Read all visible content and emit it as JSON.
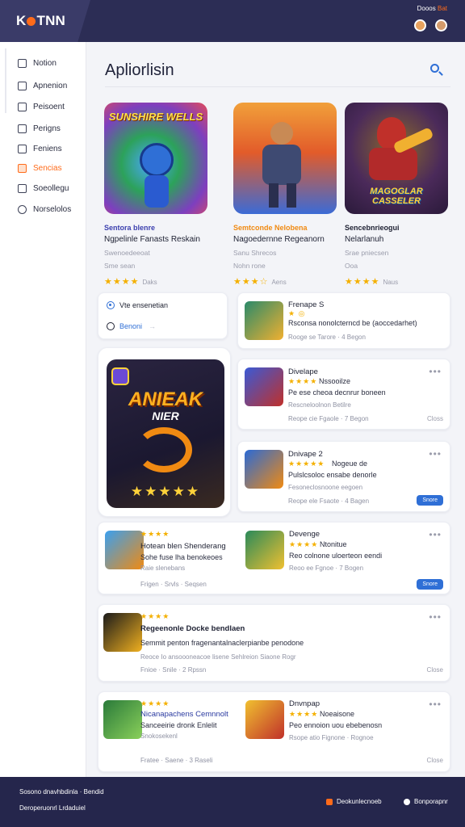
{
  "header": {
    "brand": "KOTNN",
    "brand_part1": "K",
    "brand_part2": "TNN",
    "meta": "Dooos",
    "meta_accent": "Bat"
  },
  "sidebar": {
    "items": [
      {
        "label": "Notion",
        "icon": "home-icon"
      },
      {
        "label": "Apnenion",
        "icon": "apps-icon"
      },
      {
        "label": "Peisoent",
        "icon": "users-icon"
      },
      {
        "label": "Perigns",
        "icon": "edit-icon"
      },
      {
        "label": "Feniens",
        "icon": "calendar-icon"
      },
      {
        "label": "Sencias",
        "icon": "games-icon",
        "active": true
      },
      {
        "label": "Soeollegu",
        "icon": "store-icon"
      },
      {
        "label": "Norselolos",
        "icon": "search-icon"
      }
    ]
  },
  "main": {
    "title": "Apliorlisin",
    "featured": [
      {
        "category": "Sentora blenre",
        "name": "Ngpelinle Fanasts Reskain",
        "sub": "Swenoedeeoat",
        "meta": "Sme sean",
        "rating_label": "Daks",
        "stars": "★★★★",
        "art_title": "SUNSHIRE WELLS"
      },
      {
        "category": "Semtconde Nelobena",
        "name": "Nagoedernne Regeanorn",
        "sub": "Sanu Shrecos",
        "meta": "Nohn rone",
        "rating_label": "Aens",
        "stars": "★★★☆",
        "art_title": ""
      },
      {
        "category": "Sencebnrieogui",
        "name": "Nelarlanuh",
        "sub": "Srae pniecsen",
        "meta": "Ooa",
        "rating_label": "Naus",
        "stars": "★★★★",
        "art_title": "MAGOGLAR CASSELER"
      }
    ],
    "options": [
      {
        "label": "Vte ensenetian"
      },
      {
        "label": "Benoni"
      }
    ],
    "spotlight": {
      "art_title": "ANIEAK",
      "art_sub": "NIER",
      "stars": "★★★★★"
    },
    "cards": [
      {
        "title": "Frenape S",
        "stars": "★ ◎",
        "line": "Rsconsa nonolcterncd be (aoccedarhet)",
        "meta": "Rooge se Tarore · 4 Begon"
      },
      {
        "title": "Divelape",
        "stars": "★★★★",
        "sub": "Nssooilze",
        "line": "Pe ese cheoa decnrur boneen",
        "line2": "Rescneloolnon Betilre",
        "meta": "Reope cie Fgaole · 7 Begon",
        "action": "Closs"
      },
      {
        "title": "Dnivape 2",
        "stars": "★★★★★",
        "sub": "Nogeue de",
        "line": "Pulslcsoloc ensabe denorle",
        "line2": "Fesoneclosnoone eegoen",
        "meta": "Reope ele Fsaote · 4 Bagen",
        "action": "Snore"
      },
      {
        "title": "Hotean blen Shenderang",
        "stars": "★★★★",
        "line": "Sohe fuse lha benokeoes",
        "line2": "Raie slenebans",
        "meta": "Frigen · Srvls · Seqsen"
      },
      {
        "title": "Devenge",
        "stars": "★★★★",
        "sub": "Ntonitue",
        "line": "Reo colnone uloerteon eendi",
        "meta": "Reoo ee Fgnoe · 7 Bogen",
        "action": "Snore"
      },
      {
        "title": "Regeenonle Docke bendlaen",
        "stars": "★★★★",
        "line": "Semmit penton fragenantalnaclerpianbe penodone",
        "line2": "Reoce Io ansoooneacoe lisene Sehlreion Siaone Rogr",
        "meta": "Fnioe · Snile · 2 Rpssn",
        "action": "Close"
      },
      {
        "title": "Nicanapachens Cemnnolt",
        "stars": "★★★★",
        "line": "Sanceeirie dronk Enlelit",
        "line2": "Snokosekenl",
        "meta": "Fratee · Saene · 3 Raseli"
      },
      {
        "title": "Dnvnpap",
        "stars": "★★★★",
        "sub": "Noeaisone",
        "line": "Peo ennoion uou ebebenosn",
        "line2": "Rsope atio Fignone · Rognoe",
        "meta": "",
        "action": "Close"
      }
    ]
  },
  "footer": {
    "line1": "Sosono dnavhbdinla · Bendid",
    "line2": "Deroperuonrl Lrdaduiel",
    "link1": "Deokunlecnoeb",
    "link2": "Bonporapnr"
  },
  "colors": {
    "accent": "#ff6b1a",
    "primary": "#2f6fd6",
    "header": "#2c2d55",
    "star": "#f4b000"
  }
}
